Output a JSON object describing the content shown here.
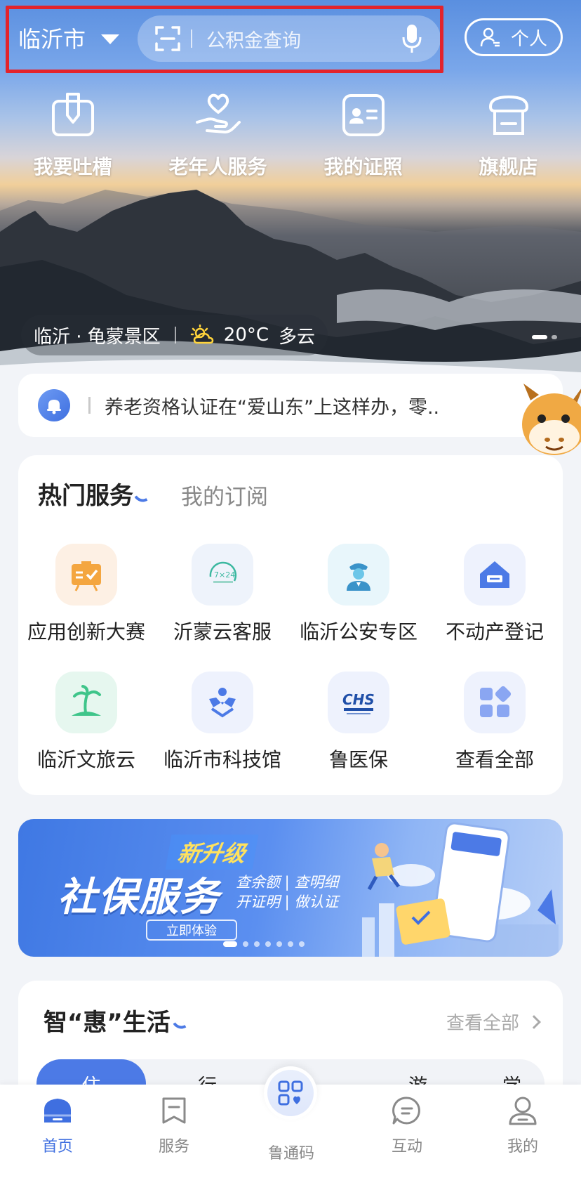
{
  "header": {
    "city": "临沂市",
    "search_placeholder": "公积金查询",
    "personal_label": "个人"
  },
  "quick_entries": [
    {
      "label": "我要吐槽",
      "icon": "feedback-icon"
    },
    {
      "label": "老年人服务",
      "icon": "elderly-heart-icon"
    },
    {
      "label": "我的证照",
      "icon": "id-card-icon"
    },
    {
      "label": "旗舰店",
      "icon": "store-icon"
    }
  ],
  "hero": {
    "location": "临沂 · 龟蒙景区",
    "temperature": "20°C",
    "weather": "多云"
  },
  "notice": {
    "text": "养老资格认证在“爱山东”上这样办，零.."
  },
  "services": {
    "tab_active": "热门服务",
    "tab_inactive": "我的订阅",
    "items": [
      {
        "label": "应用创新大赛",
        "icon": "contest-board-icon",
        "bg": "#fdf0e4"
      },
      {
        "label": "沂蒙云客服",
        "icon": "customer-service-7x24-icon",
        "bg": "#eef3fb"
      },
      {
        "label": "临沂公安专区",
        "icon": "police-officer-icon",
        "bg": "#e8f6fb"
      },
      {
        "label": "不动产登记",
        "icon": "house-icon",
        "bg": "#eef2fd"
      },
      {
        "label": "临沂文旅云",
        "icon": "palm-island-icon",
        "bg": "#e6f7ef"
      },
      {
        "label": "临沂市科技馆",
        "icon": "science-museum-icon",
        "bg": "#eef2fd"
      },
      {
        "label": "鲁医保",
        "icon": "chs-medical-insurance-icon",
        "bg": "#eef2fd"
      },
      {
        "label": "查看全部",
        "icon": "all-apps-grid-icon",
        "bg": "#eef2fd"
      }
    ]
  },
  "banner": {
    "badge": "新升级",
    "title": "社保服务",
    "subtitle_line1": "查余额 | 查明细",
    "subtitle_line2": "开证明 | 做认证",
    "button": "立即体验"
  },
  "life": {
    "title": "智“惠”生活",
    "more": "查看全部",
    "tabs": [
      "住",
      "行",
      "游",
      "学"
    ]
  },
  "bottom_nav": [
    {
      "label": "首页",
      "active": true
    },
    {
      "label": "服务",
      "active": false
    },
    {
      "label": "鲁通码",
      "active": false
    },
    {
      "label": "互动",
      "active": false
    },
    {
      "label": "我的",
      "active": false
    }
  ],
  "colors": {
    "accent": "#3f6fe0",
    "highlight_border": "#e3232c",
    "banner_badge": "#ffe25e"
  }
}
